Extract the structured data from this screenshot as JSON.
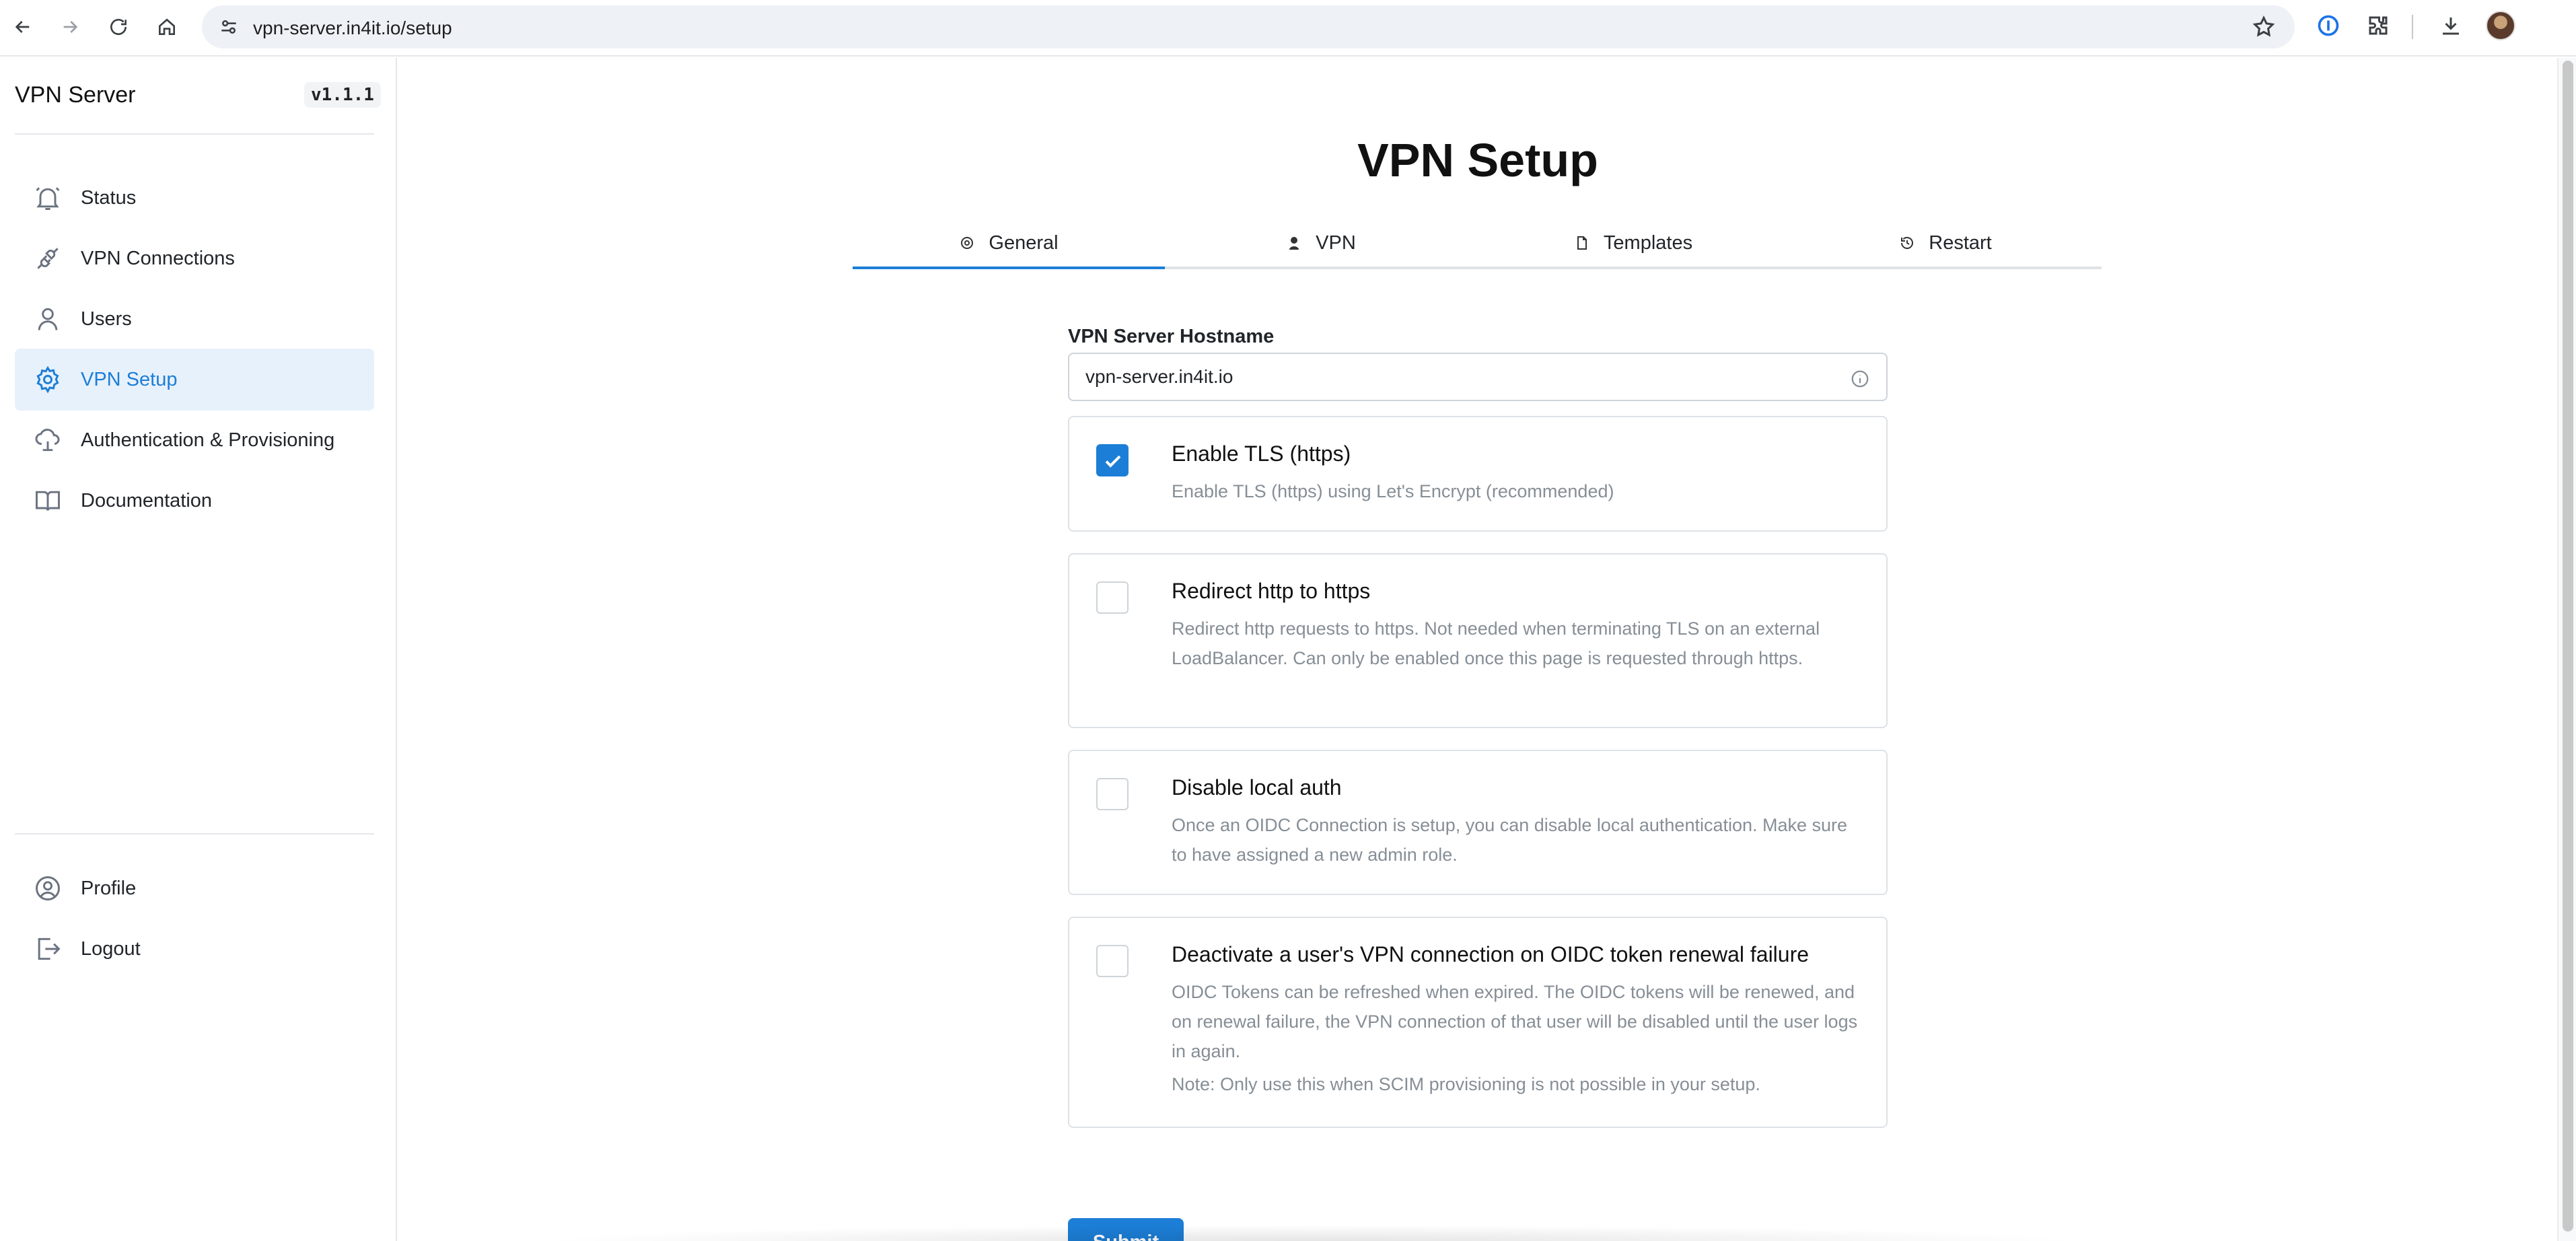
{
  "browser": {
    "url": "vpn-server.in4it.io/setup"
  },
  "sidebar": {
    "brand": "VPN Server",
    "version": "v1.1.1",
    "items": [
      {
        "label": "Status",
        "icon": "bell-icon"
      },
      {
        "label": "VPN Connections",
        "icon": "plug-icon"
      },
      {
        "label": "Users",
        "icon": "user-icon"
      },
      {
        "label": "VPN Setup",
        "icon": "gear-icon",
        "active": true
      },
      {
        "label": "Authentication & Provisioning",
        "icon": "cloud-lock-icon"
      },
      {
        "label": "Documentation",
        "icon": "book-icon"
      }
    ],
    "bottom_items": [
      {
        "label": "Profile",
        "icon": "user-circle-icon"
      },
      {
        "label": "Logout",
        "icon": "logout-icon"
      }
    ]
  },
  "main": {
    "title": "VPN Setup",
    "tabs": [
      {
        "label": "General",
        "active": true
      },
      {
        "label": "VPN"
      },
      {
        "label": "Templates"
      },
      {
        "label": "Restart"
      }
    ],
    "hostname": {
      "label": "VPN Server Hostname",
      "value": "vpn-server.in4it.io"
    },
    "options": [
      {
        "title": "Enable TLS (https)",
        "description": "Enable TLS (https) using Let's Encrypt (recommended)",
        "checked": true
      },
      {
        "title": "Redirect http to https",
        "description": "Redirect http requests to https. Not needed when terminating TLS on an external LoadBalancer. Can only be enabled once this page is requested through https.",
        "checked": false
      },
      {
        "title": "Disable local auth",
        "description": "Once an OIDC Connection is setup, you can disable local authentication. Make sure to have assigned a new admin role.",
        "checked": false
      },
      {
        "title": "Deactivate a user's VPN connection on OIDC token renewal failure",
        "description": "OIDC Tokens can be refreshed when expired. The OIDC tokens will be renewed, and on renewal failure, the VPN connection of that user will be disabled until the user logs in again.",
        "note": "Note: Only use this when SCIM provisioning is not possible in your setup.",
        "checked": false
      }
    ],
    "submit_label": "Submit"
  },
  "colors": {
    "accent": "#1c7ed6",
    "active_bg": "#e7f1fc",
    "muted_text": "#868e96"
  }
}
